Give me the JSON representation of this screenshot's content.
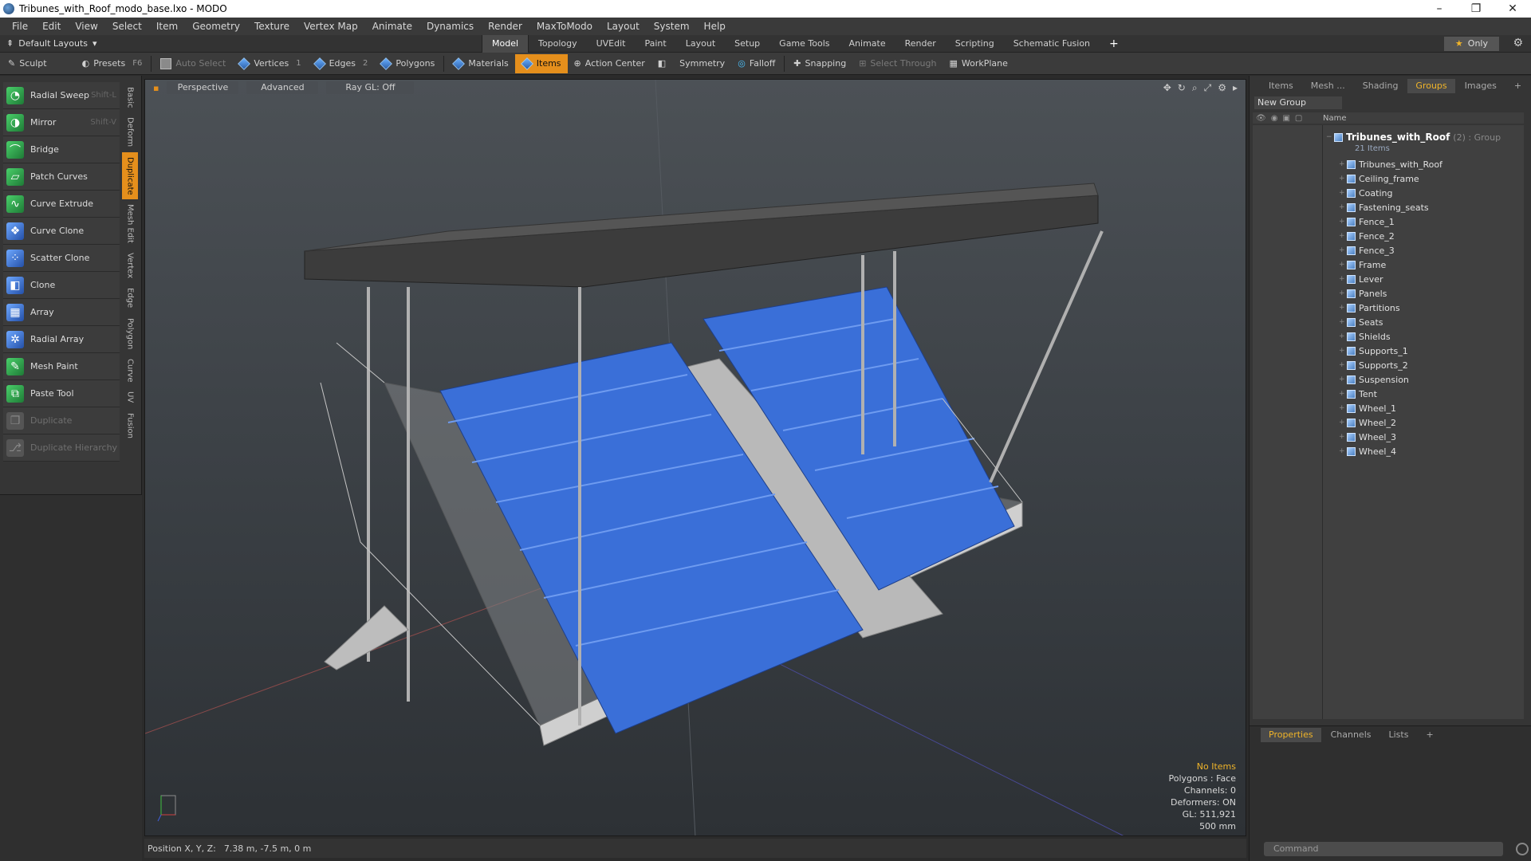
{
  "window": {
    "title": "Tribunes_with_Roof_modo_base.lxo - MODO",
    "controls": [
      "–",
      "❐",
      "✕"
    ]
  },
  "menu": [
    "File",
    "Edit",
    "View",
    "Select",
    "Item",
    "Geometry",
    "Texture",
    "Vertex Map",
    "Animate",
    "Dynamics",
    "Render",
    "MaxToModo",
    "Layout",
    "System",
    "Help"
  ],
  "layout_bar": {
    "layout_name": "Default Layouts",
    "tabs": [
      "Model",
      "Topology",
      "UVEdit",
      "Paint",
      "Layout",
      "Setup",
      "Game Tools",
      "Animate",
      "Render",
      "Scripting",
      "Schematic Fusion"
    ],
    "active_tab": "Model",
    "add_tab": "+",
    "only_label": "Only"
  },
  "toolbar": {
    "sculpt": "Sculpt",
    "presets": "Presets",
    "presets_key": "F6",
    "auto_select": "Auto Select",
    "vertices": "Vertices",
    "vertices_count": "1",
    "edges": "Edges",
    "edges_count": "2",
    "polygons": "Polygons",
    "materials": "Materials",
    "items": "Items",
    "action_center": "Action Center",
    "symmetry": "Symmetry",
    "falloff": "Falloff",
    "snapping": "Snapping",
    "select_through": "Select Through",
    "workplane": "WorkPlane"
  },
  "left_tools": [
    {
      "label": "Radial Sweep",
      "shortcut": "Shift-L",
      "icon": "radial-sweep-icon",
      "enabled": true
    },
    {
      "label": "Mirror",
      "shortcut": "Shift-V",
      "icon": "mirror-icon",
      "enabled": true
    },
    {
      "label": "Bridge",
      "shortcut": "",
      "icon": "bridge-icon",
      "enabled": true
    },
    {
      "label": "Patch Curves",
      "shortcut": "",
      "icon": "patch-curves-icon",
      "enabled": true
    },
    {
      "label": "Curve Extrude",
      "shortcut": "",
      "icon": "curve-extrude-icon",
      "enabled": true
    },
    {
      "label": "Curve Clone",
      "shortcut": "",
      "icon": "curve-clone-icon",
      "enabled": true
    },
    {
      "label": "Scatter Clone",
      "shortcut": "",
      "icon": "scatter-clone-icon",
      "enabled": true
    },
    {
      "label": "Clone",
      "shortcut": "",
      "icon": "clone-icon",
      "enabled": true
    },
    {
      "label": "Array",
      "shortcut": "",
      "icon": "array-icon",
      "enabled": true
    },
    {
      "label": "Radial Array",
      "shortcut": "",
      "icon": "radial-array-icon",
      "enabled": true
    },
    {
      "label": "Mesh Paint",
      "shortcut": "",
      "icon": "mesh-paint-icon",
      "enabled": true
    },
    {
      "label": "Paste Tool",
      "shortcut": "",
      "icon": "paste-tool-icon",
      "enabled": true
    },
    {
      "label": "Duplicate",
      "shortcut": "",
      "icon": "duplicate-icon",
      "enabled": false
    },
    {
      "label": "Duplicate Hierarchy",
      "shortcut": "",
      "icon": "duplicate-hierarchy-icon",
      "enabled": false
    }
  ],
  "left_vtabs": [
    "Basic",
    "Deform",
    "Duplicate",
    "Mesh Edit",
    "Vertex",
    "Edge",
    "Polygon",
    "Curve",
    "UV",
    "Fusion"
  ],
  "left_vtab_active": "Duplicate",
  "viewport": {
    "view_mode": "Perspective",
    "shading": "Advanced",
    "raygl": "Ray GL: Off",
    "stats": {
      "selection": "No Items",
      "polygons": "Polygons : Face",
      "channels": "Channels: 0",
      "deformers": "Deformers: ON",
      "gl": "GL: 511,921",
      "scale": "500 mm"
    }
  },
  "status": {
    "position_label": "Position X, Y, Z:",
    "position_value": "7.38 m, -7.5 m, 0 m"
  },
  "right_panel": {
    "tabs": [
      "Items",
      "Mesh ...",
      "Shading",
      "Groups",
      "Images"
    ],
    "active_tab": "Groups",
    "new_group": "New Group",
    "column_name": "Name",
    "group_name": "Tribunes_with_Roof",
    "group_meta": "(2) : Group",
    "group_count": "21 Items",
    "items": [
      "Tribunes_with_Roof",
      "Ceiling_frame",
      "Coating",
      "Fastening_seats",
      "Fence_1",
      "Fence_2",
      "Fence_3",
      "Frame",
      "Lever",
      "Panels",
      "Partitions",
      "Seats",
      "Shields",
      "Supports_1",
      "Supports_2",
      "Suspension",
      "Tent",
      "Wheel_1",
      "Wheel_2",
      "Wheel_3",
      "Wheel_4"
    ],
    "lower_tabs": [
      "Properties",
      "Channels",
      "Lists"
    ],
    "lower_active": "Properties",
    "command_placeholder": "Command"
  },
  "colors": {
    "accent": "#e58f1c",
    "seat_blue": "#3a6fd8",
    "highlight_text": "#f0b429"
  }
}
